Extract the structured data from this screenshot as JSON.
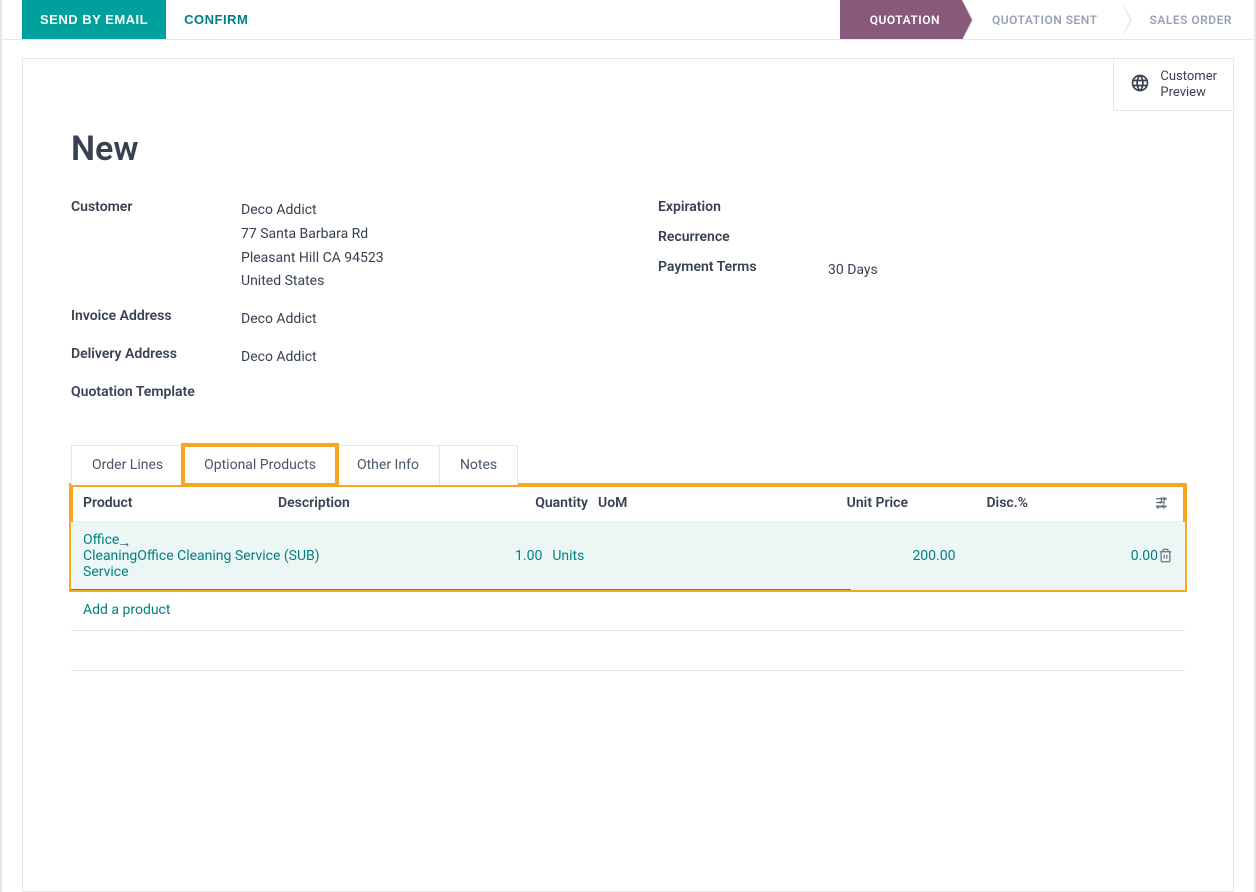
{
  "actions": {
    "send_email": "SEND BY EMAIL",
    "confirm": "CONFIRM"
  },
  "stages": {
    "quotation": "QUOTATION",
    "quotation_sent": "QUOTATION SENT",
    "sales_order": "SALES ORDER"
  },
  "customer_preview": "Customer Preview",
  "title": "New",
  "fields": {
    "customer_label": "Customer",
    "customer_name": "Deco Addict",
    "customer_addr1": "77 Santa Barbara Rd",
    "customer_addr2": "Pleasant Hill CA 94523",
    "customer_country": "United States",
    "invoice_label": "Invoice Address",
    "invoice_value": "Deco Addict",
    "delivery_label": "Delivery Address",
    "delivery_value": "Deco Addict",
    "template_label": "Quotation Template",
    "template_value": "",
    "expiration_label": "Expiration",
    "expiration_value": "",
    "recurrence_label": "Recurrence",
    "recurrence_value": "",
    "payment_label": "Payment Terms",
    "payment_value": "30 Days"
  },
  "tabs": {
    "order_lines": "Order Lines",
    "optional_products": "Optional Products",
    "other_info": "Other Info",
    "notes": "Notes"
  },
  "grid": {
    "headers": {
      "product": "Product",
      "description": "Description",
      "quantity": "Quantity",
      "uom": "UoM",
      "unit_price": "Unit Price",
      "discount": "Disc.%"
    },
    "row": {
      "product": "Office Cleaning Service",
      "description": "Office Cleaning Service (SUB)",
      "quantity": "1.00",
      "uom": "Units",
      "unit_price": "200.00",
      "discount": "0.00"
    },
    "add_product": "Add a product"
  }
}
